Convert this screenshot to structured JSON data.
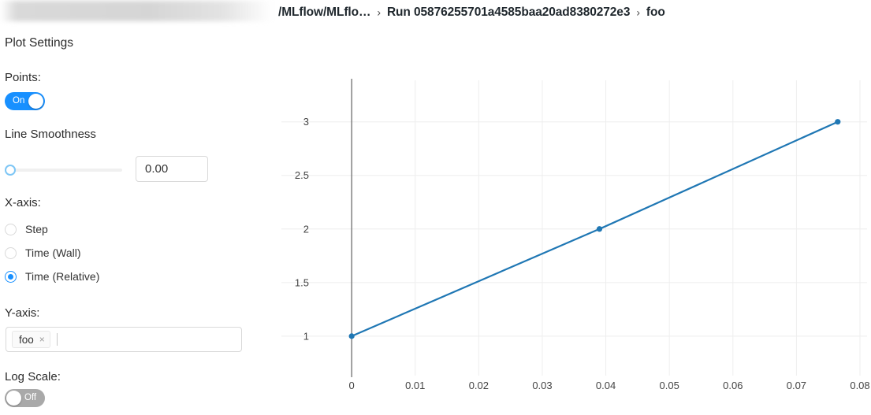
{
  "breadcrumb": {
    "items": [
      {
        "label": "/MLflow/MLflo…",
        "truncated": true
      },
      {
        "label": "Run 05876255701a4585baa20ad8380272e3"
      },
      {
        "label": "foo"
      }
    ],
    "separator": "›"
  },
  "sidebar": {
    "panel_title": "Plot Settings",
    "points": {
      "label": "Points:",
      "state": "On",
      "enabled": true
    },
    "line_smoothness": {
      "label": "Line Smoothness",
      "value": "0.00",
      "slider_percent": 0
    },
    "x_axis": {
      "label": "X-axis:",
      "options": [
        {
          "label": "Step",
          "selected": false
        },
        {
          "label": "Time (Wall)",
          "selected": false
        },
        {
          "label": "Time (Relative)",
          "selected": true
        }
      ]
    },
    "y_axis": {
      "label": "Y-axis:",
      "tags": [
        {
          "label": "foo",
          "remove_icon": "×"
        }
      ],
      "placeholder": ""
    },
    "log_scale": {
      "label": "Log Scale:",
      "state": "Off",
      "enabled": false
    }
  },
  "colors": {
    "accent": "#1890ff",
    "series": "#1f77b4",
    "grid": "#eeeeee",
    "axis": "#555555",
    "toggle_off": "#a9a9a9"
  },
  "chart_data": {
    "type": "line",
    "title": "",
    "xlabel": "",
    "ylabel": "",
    "xlim": [
      -0.0025,
      0.08
    ],
    "ylim": [
      0.83,
      3.13
    ],
    "xticks": [
      0,
      0.01,
      0.02,
      0.03,
      0.04,
      0.05,
      0.06,
      0.07,
      0.08
    ],
    "xticklabels": [
      "0",
      "0.01",
      "0.02",
      "0.03",
      "0.04",
      "0.05",
      "0.06",
      "0.07",
      "0.08"
    ],
    "yticks": [
      1,
      1.5,
      2,
      2.5,
      3
    ],
    "yticklabels": [
      "1",
      "1.5",
      "2",
      "2.5",
      "3"
    ],
    "grid": true,
    "legend": false,
    "markers": true,
    "series": [
      {
        "name": "foo",
        "color": "#1f77b4",
        "x": [
          0,
          0.039,
          0.0765
        ],
        "y": [
          1,
          2,
          3
        ]
      }
    ]
  }
}
